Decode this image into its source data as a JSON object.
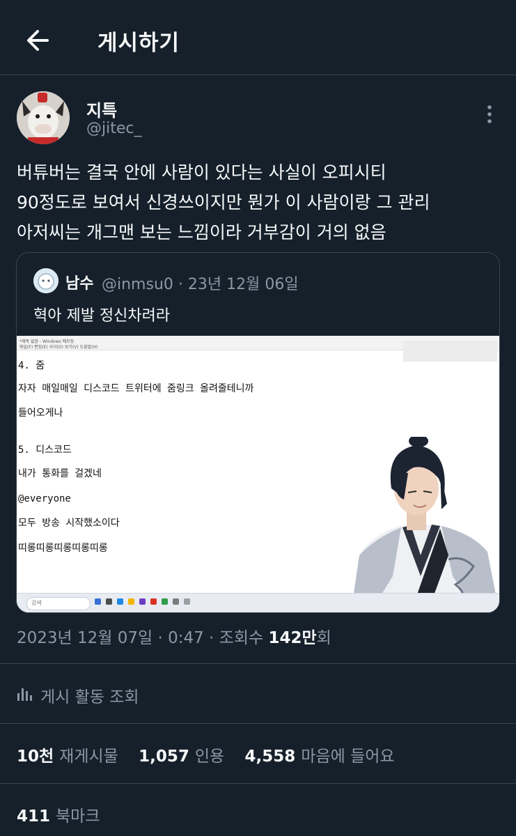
{
  "header": {
    "title": "게시하기",
    "back_icon": "arrow-left-icon"
  },
  "tweet": {
    "author_name": "지특",
    "author_handle": "@jitec_",
    "text_lines": [
      "버튜버는 결국 안에 사람이 있다는 사실이 오피시티",
      "90정도로 보여서 신경쓰이지만 뭔가 이 사람이랑 그 관리",
      "아저씨는 개그맨 보는 느낌이라 거부감이 거의 없음"
    ],
    "more_icon": "more-vertical-icon"
  },
  "quote": {
    "author_name": "남수",
    "meta": "@inmsu0 · 23년 12월 06일",
    "text": "혁아 제발 정신차려라",
    "image": {
      "notes": [
        "4. 줌",
        "자자 매일매일 디스코드 트위터에 줌링크 올려줄테니까",
        "들어오게나",
        "5. 디스코드",
        "내가 통화를 걸겠네",
        "@everyone",
        "모두 방송 시작했소이다",
        "띠롱띠롱띠롱띠롱띠롱"
      ],
      "window_title": "*제목 없음 - Windows 메모장",
      "window_menu": "파일(F)  편집(E)  서식(O)  보기(V)  도움말(H)",
      "taskbar_search": "검색"
    }
  },
  "timestamp": {
    "date": "2023년 12월 07일 · 0:47 · 조회수 ",
    "views_num": "142만",
    "views_suffix": "회"
  },
  "activity": {
    "label": "게시 활동 조회",
    "icon": "bar-chart-icon"
  },
  "stats": {
    "retweets": {
      "num": "10천",
      "label": "재게시물"
    },
    "quotes": {
      "num": "1,057",
      "label": "인용"
    },
    "likes": {
      "num": "4,558",
      "label": "마음에 들어요"
    }
  },
  "bookmarks": {
    "num": "411",
    "label": "북마크"
  },
  "colors": {
    "background": "#15202b",
    "text": "#f7f9f9",
    "secondary": "#8b98a5",
    "border": "#38444d"
  }
}
